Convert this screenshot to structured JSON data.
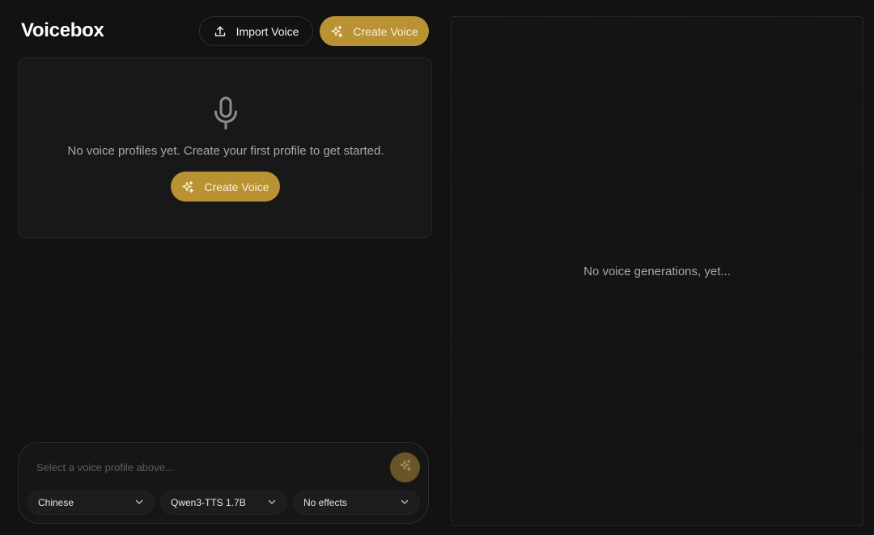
{
  "app": {
    "title": "Voicebox"
  },
  "header": {
    "import_label": "Import Voice",
    "create_label": "Create Voice"
  },
  "profiles": {
    "empty_message": "No voice profiles yet. Create your first profile to get started.",
    "create_label": "Create Voice"
  },
  "generations": {
    "empty_message": "No voice generations, yet..."
  },
  "composer": {
    "placeholder": "Select a voice profile above...",
    "language": "Chinese",
    "model": "Qwen3-TTS 1.7B",
    "effects": "No effects"
  },
  "icons": {
    "import": "upload-icon",
    "create": "sparkles-icon",
    "empty_state": "microphone-icon",
    "generate": "sparkles-icon",
    "dropdown": "chevron-down-icon"
  },
  "colors": {
    "background": "#121212",
    "accent": "#b99233",
    "accent_muted": "#6a5528",
    "panel": "#181818"
  }
}
